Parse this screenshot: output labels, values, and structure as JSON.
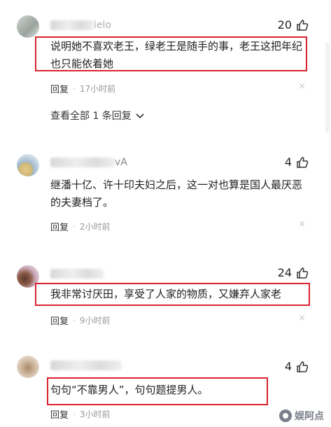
{
  "comments": [
    {
      "username_tail": "ielo",
      "likes": "20",
      "text": "说明她不喜欢老王，绿老王是随手的事，老王这把年纪也只能依着她",
      "reply": "回复",
      "time": "17小时前",
      "close": "×",
      "view_all": "查看全部 1 条回复"
    },
    {
      "username_tail": "vA",
      "likes": "4",
      "text": "继潘十亿、许十印夫妇之后，这一对也算是国人最厌恶的夫妻档了。",
      "reply": "回复",
      "time": "2小时前",
      "close": "×"
    },
    {
      "username_tail": "",
      "likes": "24",
      "text": "我非常讨厌田，享受了人家的物质，又嫌弃人家老",
      "reply": "回复",
      "time": "9小时前",
      "close": "×"
    },
    {
      "username_tail": "",
      "likes": "4",
      "text": "句句“不靠男人”，句句题提男人。",
      "reply": "回复",
      "time": "3小时前",
      "close": "×"
    }
  ],
  "watermark": "娱阿点",
  "colors": {
    "highlight_box": "#d9232e",
    "meta": "#999999"
  },
  "icons": [
    "thumbs-up-icon",
    "chevron-down-icon",
    "close-icon"
  ]
}
